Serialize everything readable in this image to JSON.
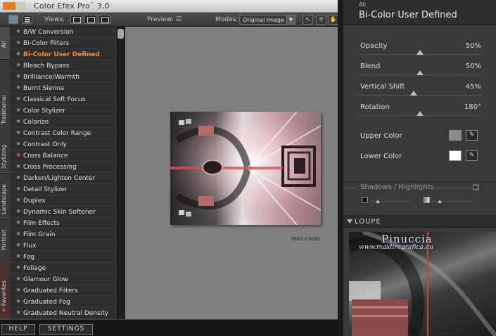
{
  "app": {
    "title": "Color Efex Pro",
    "title_tm": "™",
    "version": "3.0"
  },
  "toolbar": {
    "views_label": "Views:",
    "preview_label": "Preview:",
    "preview_check": "☑",
    "modes_label": "Modes:",
    "modes_value": "Original Image"
  },
  "tabs": [
    "All",
    "Traditional",
    "Stylizing",
    "Landscape",
    "Portrait",
    "Favorites"
  ],
  "favorites_star": "★",
  "filters": [
    {
      "label": "B/W Conversion"
    },
    {
      "label": "Bi-Color Filters"
    },
    {
      "label": "Bi-Color User Defined",
      "selected": true
    },
    {
      "label": "Bleach Bypass"
    },
    {
      "label": "Brilliance/Warmth"
    },
    {
      "label": "Burnt Sienna"
    },
    {
      "label": "Classical Soft Focus"
    },
    {
      "label": "Color Stylizer"
    },
    {
      "label": "Colorize"
    },
    {
      "label": "Contrast Color Range"
    },
    {
      "label": "Contrast Only"
    },
    {
      "label": "Cross Balance",
      "favorite": true
    },
    {
      "label": "Cross Processing"
    },
    {
      "label": "Darken/Lighten Center"
    },
    {
      "label": "Detail Stylizer"
    },
    {
      "label": "Duplex"
    },
    {
      "label": "Dynamic Skin Softener"
    },
    {
      "label": "Film Effects"
    },
    {
      "label": "Film Grain"
    },
    {
      "label": "Flux"
    },
    {
      "label": "Fog"
    },
    {
      "label": "Foliage"
    },
    {
      "label": "Glamour Glow"
    },
    {
      "label": "Graduated Filters"
    },
    {
      "label": "Graduated Fog"
    },
    {
      "label": "Graduated Neutral Density"
    }
  ],
  "canvas": {
    "image_size": "(800 x 600)"
  },
  "bottom": {
    "help": "HELP",
    "settings": "SETTINGS"
  },
  "panel": {
    "category": "All",
    "filter_title": "Bi-Color User Defined",
    "sliders": [
      {
        "label": "Opacity",
        "value": "50%",
        "fraction": 0.5
      },
      {
        "label": "Blend",
        "value": "50%",
        "fraction": 0.5
      },
      {
        "label": "Vertical Shift",
        "value": "45%",
        "fraction": 0.45
      },
      {
        "label": "Rotation",
        "value": "180°",
        "fraction": 0.5
      }
    ],
    "upper_color": {
      "label": "Upper Color",
      "hex": "#8a8a8a"
    },
    "lower_color": {
      "label": "Lower Color",
      "hex": "#ffffff"
    },
    "shadows_label": "Shadows / Highlights",
    "shadow_fraction": 0.2,
    "highlight_fraction": 0.2
  },
  "loupe": {
    "label": "LOUPE",
    "watermark_name": "Pinuccia",
    "watermark_url": "www.maidiregrafica.eu"
  },
  "colors": {
    "accent": "#ff8a2a",
    "favorite_star": "#e05050"
  }
}
